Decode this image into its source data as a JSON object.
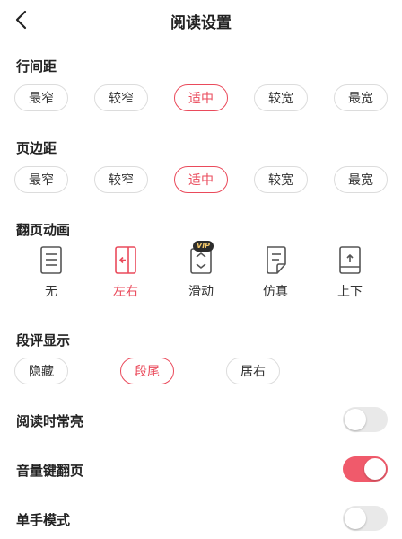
{
  "header": {
    "title": "阅读设置",
    "back_icon": "chevron-left-icon"
  },
  "line_spacing": {
    "label": "行间距",
    "options": [
      "最窄",
      "较窄",
      "适中",
      "较宽",
      "最宽"
    ],
    "selected": "适中"
  },
  "page_margin": {
    "label": "页边距",
    "options": [
      "最窄",
      "较窄",
      "适中",
      "较宽",
      "最宽"
    ],
    "selected": "适中"
  },
  "page_turn": {
    "label": "翻页动画",
    "options": [
      {
        "label": "无",
        "icon": "page-lines-icon"
      },
      {
        "label": "左右",
        "icon": "page-arrow-left-icon"
      },
      {
        "label": "滑动",
        "icon": "scroll-updown-icon",
        "badge": "VIP"
      },
      {
        "label": "仿真",
        "icon": "page-curl-icon"
      },
      {
        "label": "上下",
        "icon": "page-arrow-up-icon"
      }
    ],
    "selected": "左右"
  },
  "paragraph_comment": {
    "label": "段评显示",
    "options": [
      "隐藏",
      "段尾",
      "居右"
    ],
    "selected": "段尾"
  },
  "toggles": [
    {
      "label": "阅读时常亮",
      "on": false
    },
    {
      "label": "音量键翻页",
      "on": true
    },
    {
      "label": "单手模式",
      "on": false
    }
  ],
  "colors": {
    "accent": "#ea4a5b",
    "toggle_on": "#f05a6b",
    "toggle_off": "#e9e9e9",
    "pill_border": "#dcdcdc",
    "icon_gray": "#555555"
  }
}
